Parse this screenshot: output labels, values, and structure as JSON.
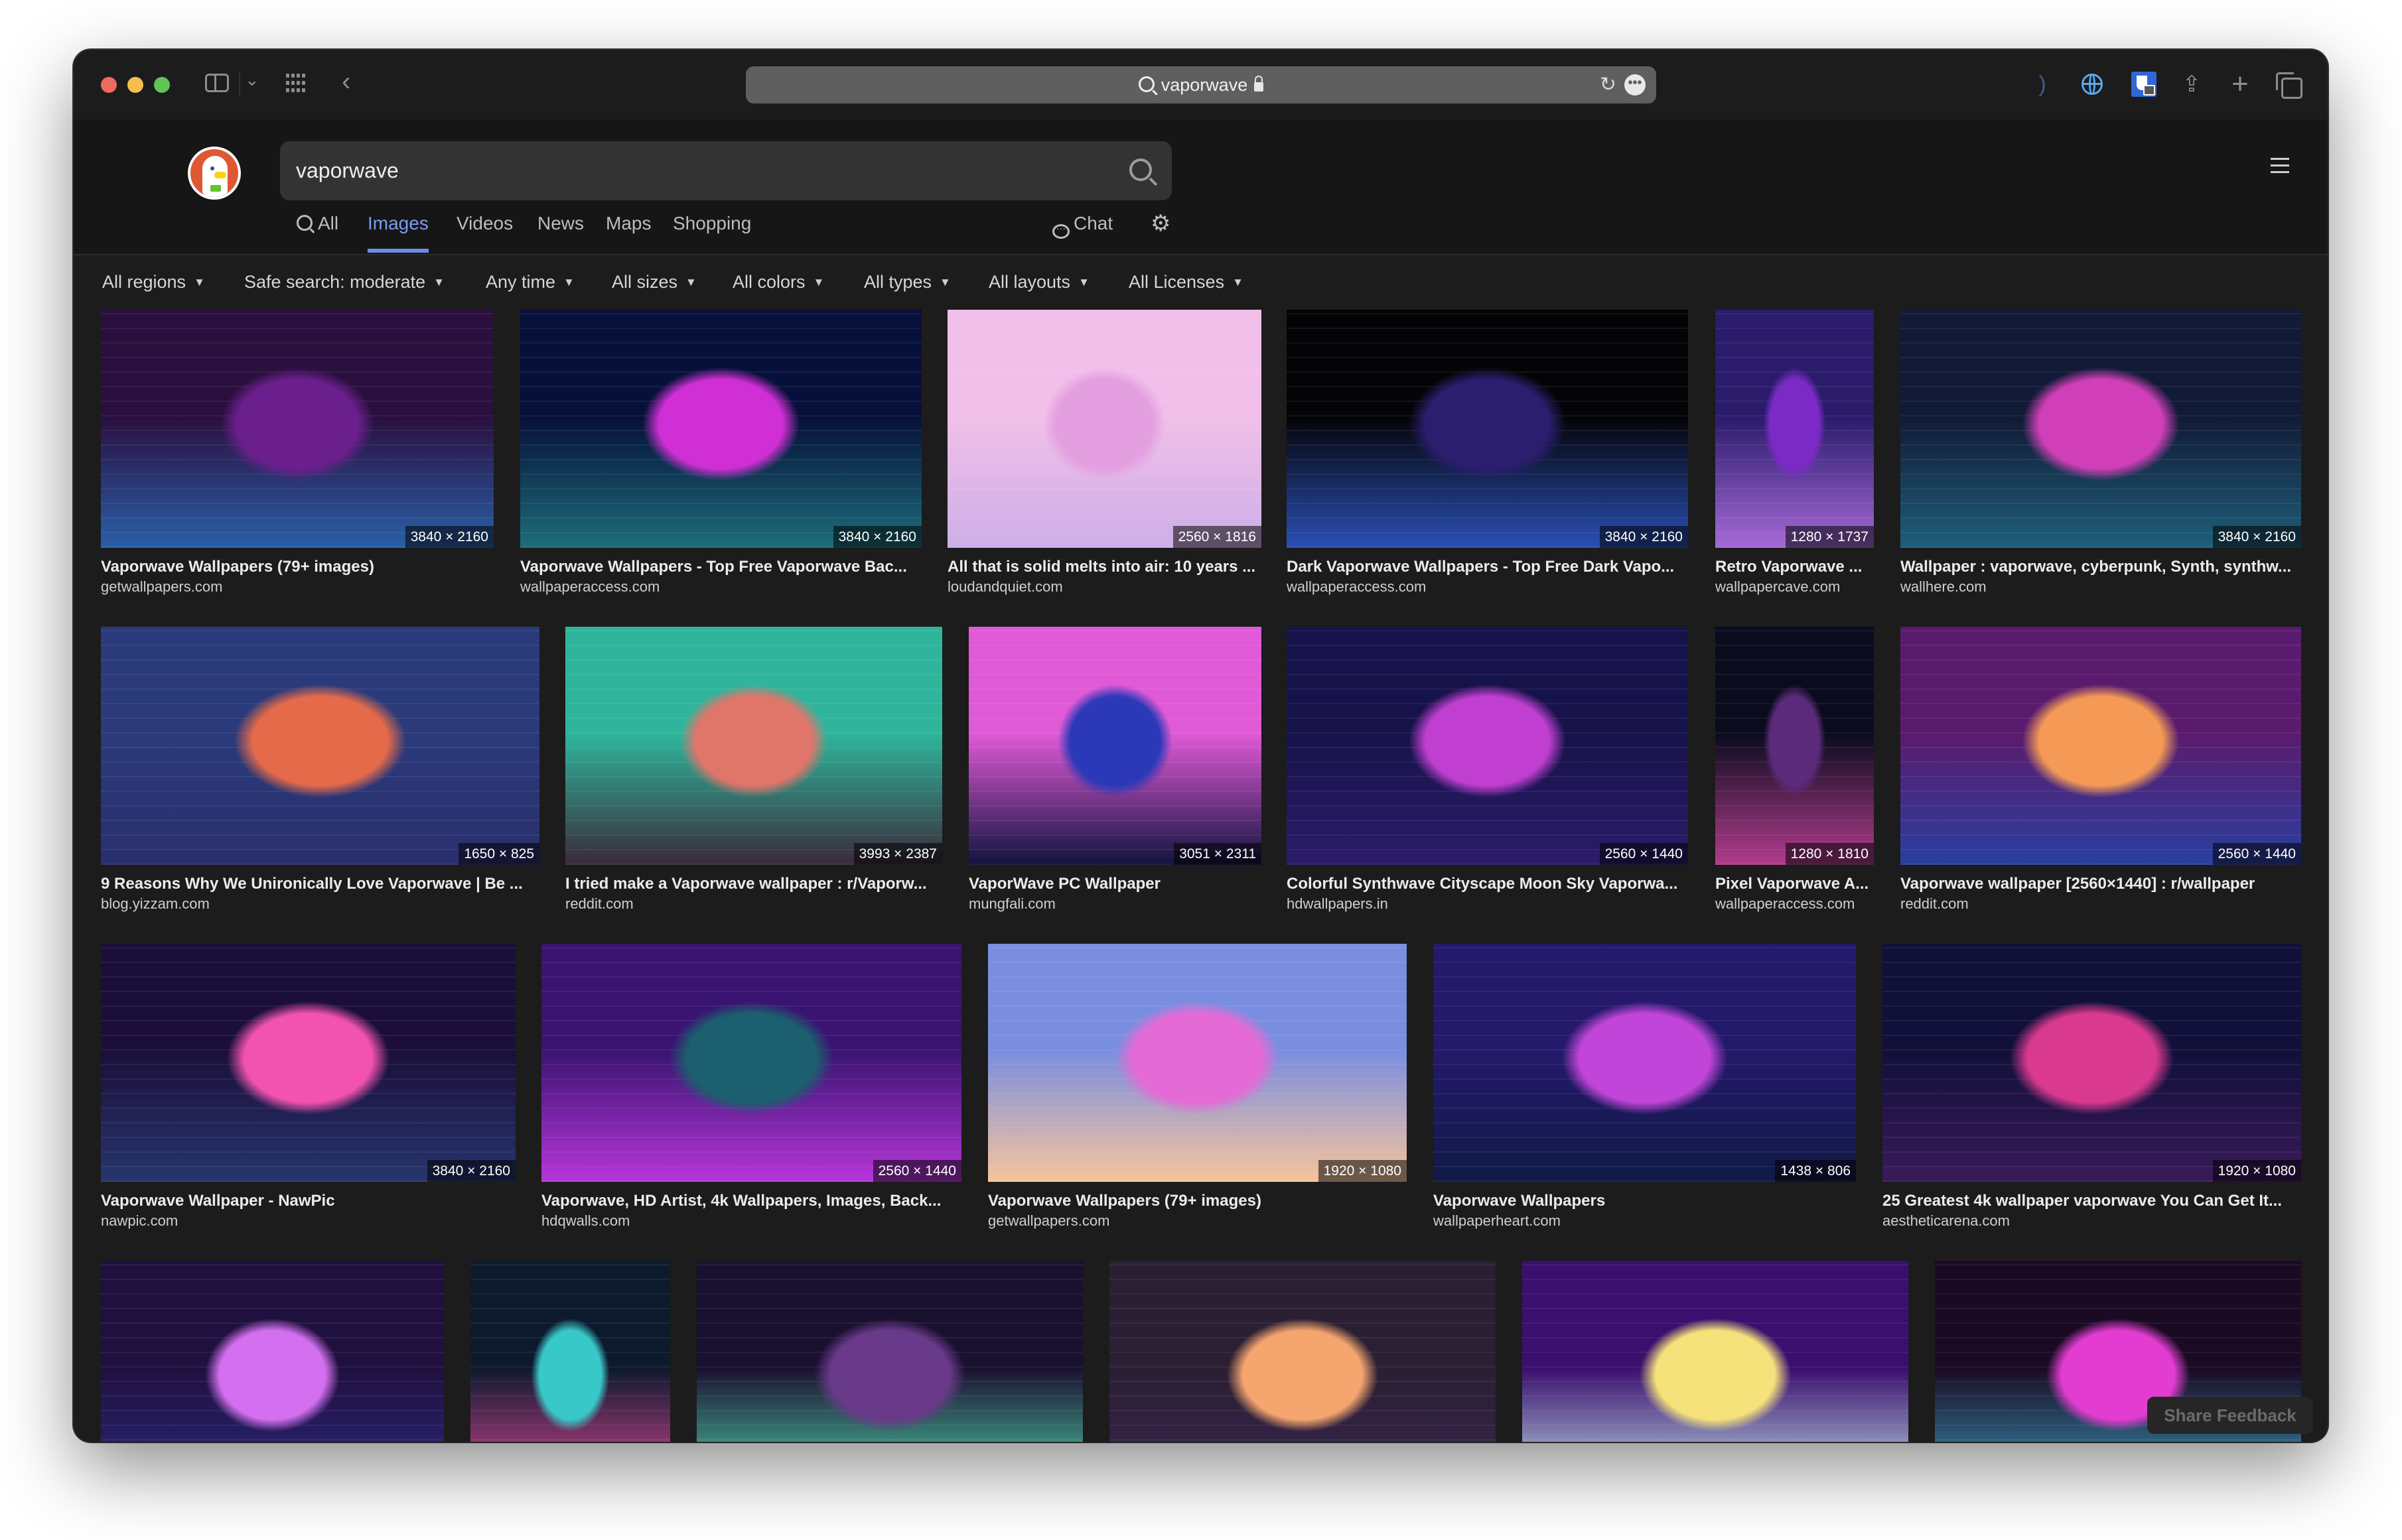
{
  "browser": {
    "address_query": "vaporwave",
    "icons": {
      "sidebar": "sidebar-toggle-icon",
      "tab_groups": "chevron-down-icon",
      "tab_overview_grid": "grid-icon",
      "back": "back-arrow-icon",
      "search": "magnifier-icon",
      "lock": "lock-icon",
      "reload": "reload-icon",
      "more": "ellipsis-icon",
      "rss": "rss-icon",
      "translate": "globe-icon",
      "password_manager": "bitwarden-icon",
      "share": "share-icon",
      "new_tab": "plus-icon",
      "tabs": "tabs-overview-icon"
    },
    "reload_glyph": "↻",
    "more_glyph": "•••",
    "rss_glyph": "〜",
    "share_glyph": "⇪",
    "plus_glyph": "+"
  },
  "header": {
    "logo_alt": "DuckDuckGo",
    "search_value": "vaporwave",
    "tabs": [
      {
        "label": "All",
        "active": false
      },
      {
        "label": "Images",
        "active": true
      },
      {
        "label": "Videos",
        "active": false
      },
      {
        "label": "News",
        "active": false
      },
      {
        "label": "Maps",
        "active": false
      },
      {
        "label": "Shopping",
        "active": false
      }
    ],
    "chat_label": "Chat",
    "chat_glyph": "···",
    "settings_glyph": "⚙",
    "accent_color": "#7c9cf2"
  },
  "filters": [
    {
      "label": "All regions"
    },
    {
      "label": "Safe search: moderate"
    },
    {
      "label": "Any time"
    },
    {
      "label": "All sizes"
    },
    {
      "label": "All colors"
    },
    {
      "label": "All types"
    },
    {
      "label": "All layouts"
    },
    {
      "label": "All Licenses"
    }
  ],
  "caret_glyph": "▼",
  "results": [
    [
      {
        "title": "Vaporwave Wallpapers (79+ images)",
        "site": "getwallpapers.com",
        "dims": "3840 × 2160",
        "colors": [
          "#2a0f3f",
          "#6b1f8c",
          "#2a5fa8"
        ]
      },
      {
        "title": "Vaporwave Wallpapers - Top Free Vaporwave Bac...",
        "site": "wallpaperaccess.com",
        "dims": "3840 × 2160",
        "colors": [
          "#07103a",
          "#d12fd6",
          "#1b6e7a"
        ]
      },
      {
        "title": "All that is solid melts into air: 10 years ...",
        "site": "loudandquiet.com",
        "dims": "2560 × 1816",
        "colors": [
          "#f1bfe9",
          "#e49fe0",
          "#cdaee8"
        ]
      },
      {
        "title": "Dark Vaporwave Wallpapers - Top Free Dark Vapo...",
        "site": "wallpaperaccess.com",
        "dims": "3840 × 2160",
        "colors": [
          "#040407",
          "#2b1e6e",
          "#2a4fb5"
        ]
      },
      {
        "title": "Retro Vaporwave ...",
        "site": "wallpapercave.com",
        "dims": "1280 × 1737",
        "colors": [
          "#2a1b6b",
          "#7b2ac6",
          "#a66ad8"
        ]
      },
      {
        "title": "Wallpaper : vaporwave, cyberpunk, Synth, synthw...",
        "site": "wallhere.com",
        "dims": "3840 × 2160",
        "colors": [
          "#111a36",
          "#d13fb8",
          "#1f5f7a"
        ]
      }
    ],
    [
      {
        "title": "9 Reasons Why We Unironically Love Vaporwave | Be ...",
        "site": "blog.yizzam.com",
        "dims": "1650 × 825",
        "colors": [
          "#2b3a7a",
          "#e46a4a",
          "#2a2f6e"
        ]
      },
      {
        "title": "I tried make a Vaporwave wallpaper : r/Vaporw...",
        "site": "reddit.com",
        "dims": "3993 × 2387",
        "colors": [
          "#2fb59b",
          "#e0756a",
          "#3a2a3a"
        ]
      },
      {
        "title": "VaporWave PC Wallpaper",
        "site": "mungfali.com",
        "dims": "3051 × 2311",
        "colors": [
          "#e059d7",
          "#2b39b8",
          "#10143e"
        ]
      },
      {
        "title": "Colorful Synthwave Cityscape Moon Sky Vaporwa...",
        "site": "hdwallpapers.in",
        "dims": "2560 × 1440",
        "colors": [
          "#16124a",
          "#c03fd0",
          "#2c1c6a"
        ]
      },
      {
        "title": "Pixel Vaporwave A...",
        "site": "wallpaperaccess.com",
        "dims": "1280 × 1810",
        "colors": [
          "#0b0b1e",
          "#5c2a7a",
          "#b13c8c"
        ]
      },
      {
        "title": "Vaporwave wallpaper [2560×1440] : r/wallpaper",
        "site": "reddit.com",
        "dims": "2560 × 1440",
        "colors": [
          "#5a1b6e",
          "#f49a56",
          "#2a3f9f"
        ]
      }
    ],
    [
      {
        "title": "Vaporwave Wallpaper - NawPic",
        "site": "nawpic.com",
        "dims": "3840 × 2160",
        "colors": [
          "#1b0f3a",
          "#f253b0",
          "#27356e"
        ]
      },
      {
        "title": "Vaporwave, HD Artist, 4k Wallpapers, Images, Back...",
        "site": "hdqwalls.com",
        "dims": "2560 × 1440",
        "colors": [
          "#3a1472",
          "#1c5f6e",
          "#b635d9"
        ]
      },
      {
        "title": "Vaporwave Wallpapers (79+ images)",
        "site": "getwallpapers.com",
        "dims": "1920 × 1080",
        "colors": [
          "#7a8ee0",
          "#e46bd6",
          "#f7c49a"
        ]
      },
      {
        "title": "Vaporwave Wallpapers",
        "site": "wallpaperheart.com",
        "dims": "1438 × 806",
        "colors": [
          "#24196a",
          "#c245d9",
          "#101a46"
        ]
      },
      {
        "title": "25 Greatest 4k wallpaper vaporwave You Can Get It...",
        "site": "aestheticarena.com",
        "dims": "1920 × 1080",
        "colors": [
          "#11103a",
          "#d9398f",
          "#3a1a5a"
        ]
      }
    ],
    [
      {
        "title": "",
        "site": "",
        "dims": "",
        "colors": [
          "#20103f",
          "#d46ff0",
          "#2b2a80"
        ]
      },
      {
        "title": "",
        "site": "",
        "dims": "",
        "colors": [
          "#0d1a2e",
          "#39c8c8",
          "#e5489a"
        ]
      },
      {
        "title": "",
        "site": "",
        "dims": "",
        "colors": [
          "#1a1030",
          "#6a3a8a",
          "#52e0b0"
        ]
      },
      {
        "title": "",
        "site": "",
        "dims": "",
        "colors": [
          "#2a1f33",
          "#f5a56e",
          "#3a2450"
        ]
      },
      {
        "title": "",
        "site": "",
        "dims": "",
        "colors": [
          "#3a0f6e",
          "#f6e27a",
          "#c8f0f0"
        ]
      },
      {
        "title": "",
        "site": "",
        "dims": "",
        "colors": [
          "#1a0a24",
          "#e23cd1",
          "#3aa0c0"
        ]
      }
    ]
  ],
  "share_feedback_label": "Share Feedback"
}
